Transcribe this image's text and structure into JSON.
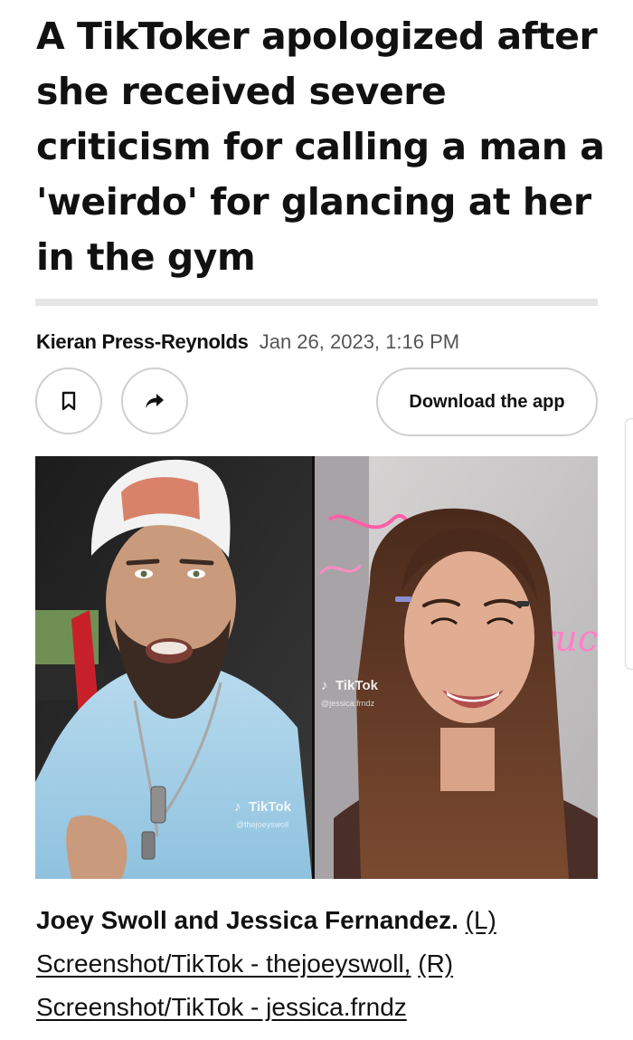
{
  "article": {
    "headline": "A TikToker apologized after she received severe criticism for calling a man a 'weirdo' for glancing at her in the gym",
    "author": "Kieran Press-Reynolds",
    "date": "Jan 26, 2023, 1:16 PM"
  },
  "actions": {
    "save_icon": "bookmark-icon",
    "share_icon": "share-arrow-icon",
    "download_label": "Download the app"
  },
  "photo": {
    "left_watermark_brand": "TikTok",
    "left_watermark_handle": "@thejoeyswoll",
    "right_watermark_brand": "TikTok",
    "right_watermark_handle": "@jessica.frndz",
    "neon_text": "ruc"
  },
  "caption": {
    "bold": "Joey Swoll and Jessica Fernandez.",
    "credit_l": "(L)",
    "credit_line_1": "Screenshot/TikTok - thejoeyswoll,",
    "credit_r": "(R)",
    "credit_line_2": "Screenshot/TikTok - jessica.frndz"
  },
  "colors": {
    "text": "#111111",
    "date": "#555555",
    "border": "#cfcfcf",
    "divider": "#e6e6e6"
  }
}
